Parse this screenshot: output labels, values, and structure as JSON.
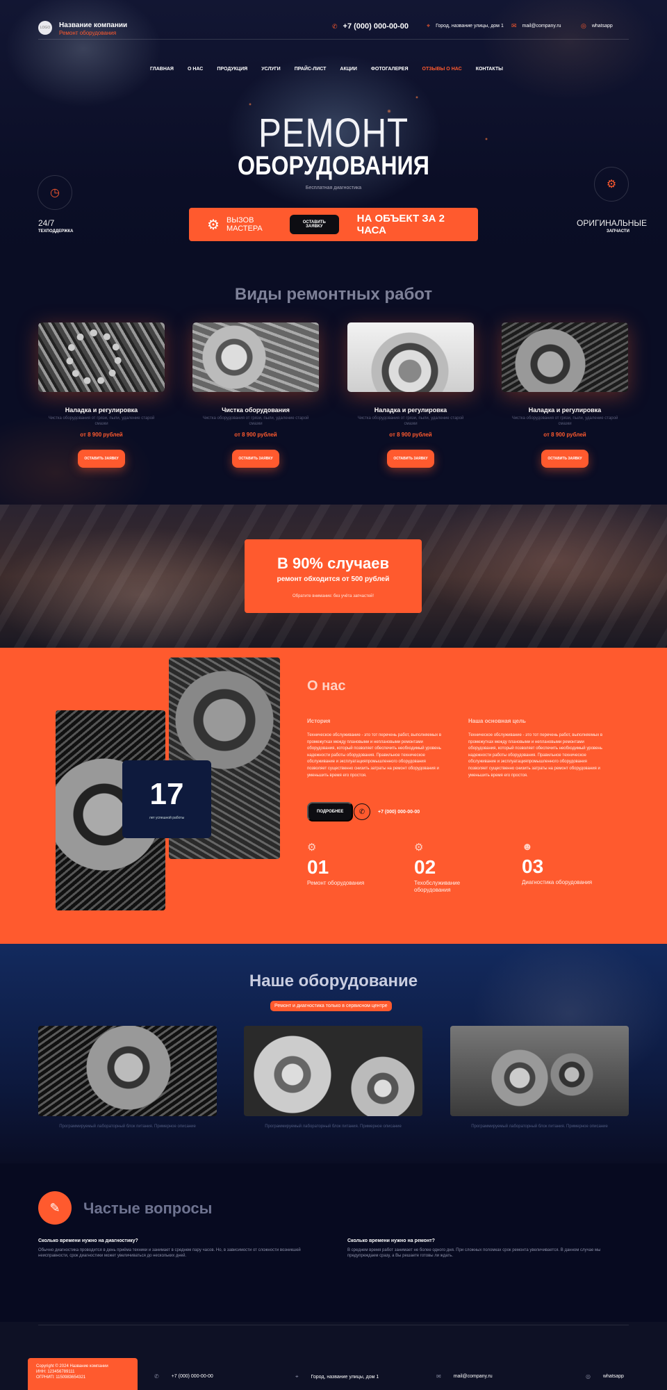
{
  "header": {
    "logo_text": "LOGO",
    "company_name": "Название компании",
    "company_sub": "Ремонт оборудования",
    "phone": "+7 (000) 000-00-00",
    "address": "Город, название улицы, дом 1",
    "email": "mail@company.ru",
    "whatsapp": "whatsapp"
  },
  "nav": [
    "Главная",
    "О нас",
    "Продукция",
    "Услуги",
    "Прайс-лист",
    "Акции",
    "Фотогалерея",
    "Отзывы о нас",
    "Контакты"
  ],
  "nav_active_index": 7,
  "hero": {
    "title1": "РЕМОНТ",
    "title2": "ОБОРУДОВАНИЯ",
    "subtitle": "Бесплатная диагностика",
    "left_big": "24/7",
    "left_small": "ТЕХПОДДЕРЖКА",
    "right_big": "ОРИГИНАЛЬНЫЕ",
    "right_small": "ЗАПЧАСТИ",
    "cta_call": "ВЫЗОВ МАСТЕРА",
    "cta_button": "ОСТАВИТЬ ЗАЯВКУ",
    "cta_onsite": "НА ОБЪЕКТ ЗА 2 ЧАСА"
  },
  "services": {
    "title": "Виды ремонтных работ",
    "items": [
      {
        "name": "Наладка и регулировка",
        "desc": "Чистка оборудования от грязи, пыли, удаление старой смазки",
        "price": "от 8 900 рублей",
        "button": "ОСТАВИТЬ ЗАЯВКУ"
      },
      {
        "name": "Чистка оборудования",
        "desc": "Чистка оборудования от грязи, пыли, удаление старой смазки",
        "price": "от 8 900 рублей",
        "button": "ОСТАВИТЬ ЗАЯВКУ"
      },
      {
        "name": "Наладка и регулировка",
        "desc": "Чистка оборудования от грязи, пыли, удаление старой смазки",
        "price": "от 8 900 рублей",
        "button": "ОСТАВИТЬ ЗАЯВКУ"
      },
      {
        "name": "Наладка и регулировка",
        "desc": "Чистка оборудования от грязи, пыли, удаление старой смазки",
        "price": "от 8 900 рублей",
        "button": "ОСТАВИТЬ ЗАЯВКУ"
      }
    ]
  },
  "promo": {
    "line1": "В 90% случаев",
    "line2": "ремонт обходится от 500 рублей",
    "line3": "Обратите внимание: без учёта запчастей!"
  },
  "about": {
    "title": "О нас",
    "years": "17",
    "years_label": "лет успешной работы",
    "history_title": "История",
    "history_text": "Техническое обслуживание - это тот перечень работ, выполняемых в промежутках между плановыми и неплановыми ремонтами оборудования, который позволяет обеспечить необходимый уровень надежности работы оборудования. Правильное техническое обслуживание и эксплуатацияпромышленного оборудования позволяет существенно снизить затраты на ремонт оборудования и уменьшить время его простоя.",
    "goal_title": "Наша основная цель",
    "goal_text": "Техническое обслуживание - это тот перечень работ, выполняемых в промежутках между плановыми и неплановыми ремонтами оборудования, который позволяет обеспечить необходимый уровень надежности работы оборудования. Правильное техническое обслуживание и эксплуатацияпромышленного оборудования позволяет существенно снизить затраты на ремонт оборудования и уменьшить время его простоя.",
    "more_button": "ПОДРОБНЕЕ",
    "phone": "+7 (000) 000-00-00",
    "stats": [
      {
        "num": "01",
        "label": "Ремонт оборудования"
      },
      {
        "num": "02",
        "label": "Техобслуживание оборудования"
      },
      {
        "num": "03",
        "label": "Диагностика оборудования"
      }
    ]
  },
  "equipment": {
    "title": "Наше оборудование",
    "badge": "Ремонт и диагностика только в сервисном центре",
    "captions": [
      "Программируемый лабораторный блок питания. Примерное описание",
      "Программируемый лабораторный блок питания. Примерное описание",
      "Программируемый лабораторный блок питания. Примерное описание"
    ]
  },
  "faq": {
    "title": "Частые вопросы",
    "items": [
      {
        "q": "Сколько времени нужно на диагностику?",
        "a": "Обычно диагностика проводится в день приёма техники и занимает в среднем пару часов. Но, в зависимости от сложности возникшей неисправности, срок диагностики может увеличиваться до нескольких дней."
      },
      {
        "q": "Сколько времени нужно на ремонт?",
        "a": "В среднем время работ занимает не более одного дня. При сложных поломках срок ремонта увеличивается. В данном случае мы предупреждаем сразу, а Вы решаете готовы ли ждать."
      }
    ]
  },
  "footer": {
    "copyright": "Copyright © 2024 Название компании",
    "inn": "ИНН: 123456789111",
    "ogrnip": "ОГРНИП: 1150983654321",
    "phone": "+7 (000) 000-00-00",
    "address": "Город, название улицы, дом 1",
    "email": "mail@company.ru",
    "whatsapp": "whatsapp"
  },
  "colors": {
    "accent": "#ff5a2e",
    "dark": "#0a0d24",
    "navy": "#132a5e"
  }
}
